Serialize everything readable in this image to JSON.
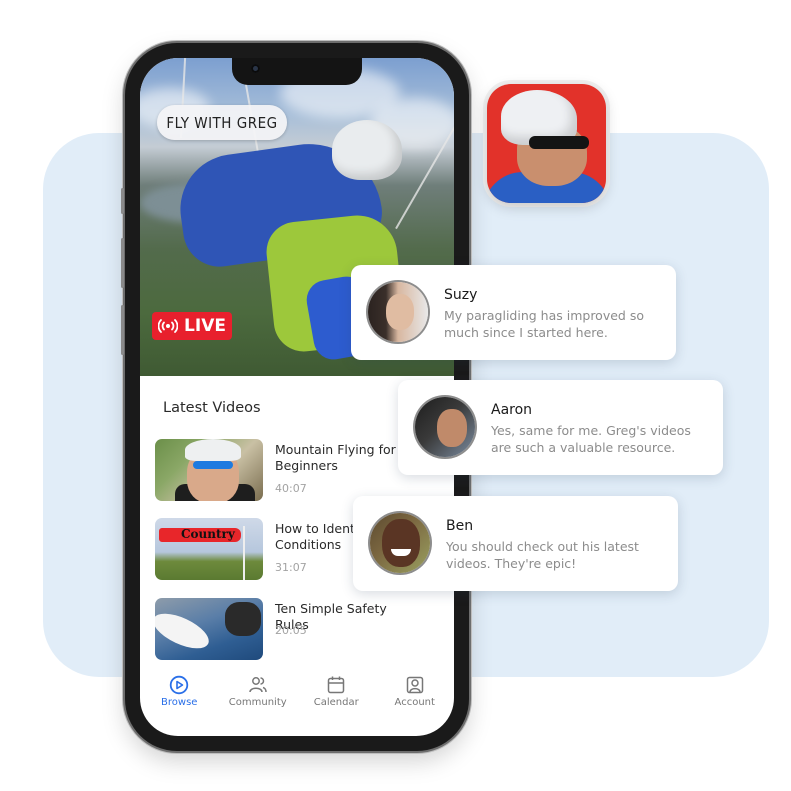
{
  "app": {
    "brand_label": "FLY WITH GREG",
    "live_badge": {
      "label": "LIVE",
      "icon": "broadcast-icon",
      "color": "#e8202d"
    },
    "accent_color": "#2a6fe8"
  },
  "latest_videos": {
    "title": "Latest Videos",
    "items": [
      {
        "title": "Mountain Flying for Beginners",
        "duration": "40:07"
      },
      {
        "title": "How to Identify Conditions",
        "duration": "31:07"
      },
      {
        "title": "Ten Simple Safety Rules",
        "duration": "20:05"
      }
    ]
  },
  "nav": {
    "items": [
      {
        "label": "Browse",
        "icon": "play-circle-icon",
        "active": true
      },
      {
        "label": "Community",
        "icon": "users-icon",
        "active": false
      },
      {
        "label": "Calendar",
        "icon": "calendar-icon",
        "active": false
      },
      {
        "label": "Account",
        "icon": "account-icon",
        "active": false
      }
    ]
  },
  "comments": [
    {
      "name": "Suzy",
      "text": "My paragliding has improved so much since I started here."
    },
    {
      "name": "Aaron",
      "text": "Yes, same for me. Greg's videos are such a valuable resource."
    },
    {
      "name": "Ben",
      "text": "You should check out his latest videos. They're epic!"
    }
  ]
}
